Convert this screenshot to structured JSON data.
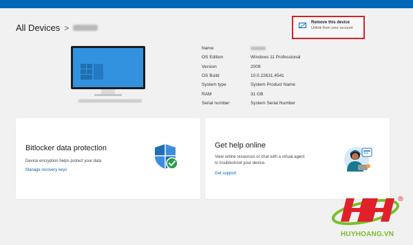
{
  "header": {
    "accent": "#0067b8"
  },
  "breadcrumb": {
    "root": "All Devices",
    "separator": ">"
  },
  "remove_device": {
    "title": "Remove this device",
    "subtitle": "Unlink from your account",
    "highlight_color": "#d3202a"
  },
  "device_info": {
    "rows": [
      {
        "label": "Name",
        "value": ""
      },
      {
        "label": "OS Edition",
        "value": "Windows 11 Professional"
      },
      {
        "label": "Version",
        "value": "2009"
      },
      {
        "label": "OS Build",
        "value": "10.0.22631.4541"
      },
      {
        "label": "System type",
        "value": "System Product Name"
      },
      {
        "label": "RAM",
        "value": "31 GB"
      },
      {
        "label": "Serial number",
        "value": "System Serial Number"
      }
    ]
  },
  "bitlocker_card": {
    "title": "Bitlocker data protection",
    "text": "Device encryption helps protect your data",
    "link": "Manage recovery keys"
  },
  "help_card": {
    "title": "Get help online",
    "text": "View online resources or chat with a virtual agent to troubleshoot your device.",
    "link": "Get support"
  },
  "watermark": {
    "text": "HUYHOANG.VN",
    "logo": "HH",
    "registered": "®"
  },
  "icons": {
    "remove": "unlink-device-icon",
    "shield": "shield-check-icon",
    "helper": "support-agent-icon",
    "monitor": "desktop-computer-icon"
  }
}
